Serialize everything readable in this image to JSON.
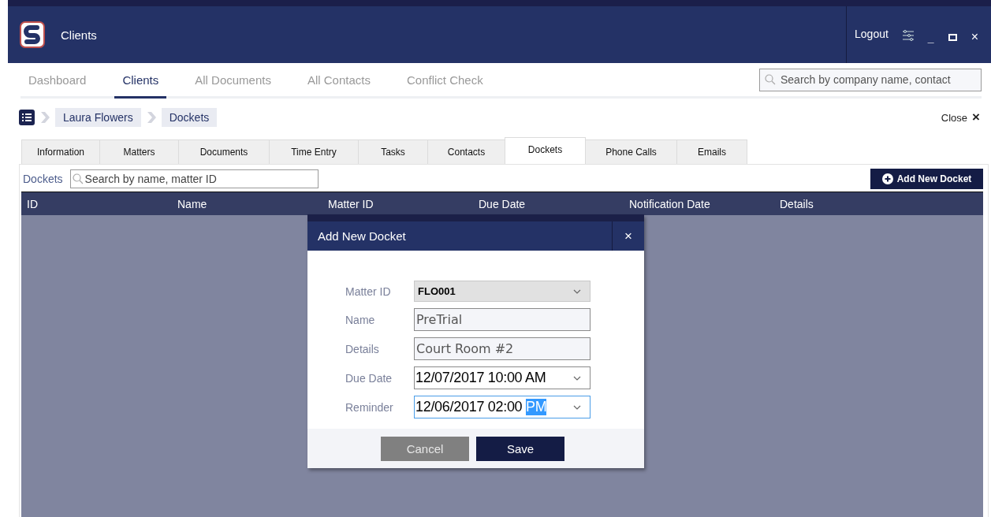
{
  "window": {
    "title": "Clients",
    "actions": [
      {
        "kind": "logout",
        "label": "Logout"
      },
      {
        "kind": "settings"
      },
      {
        "kind": "minimize",
        "label": "_"
      },
      {
        "kind": "maximize"
      },
      {
        "kind": "close",
        "label": "×"
      }
    ]
  },
  "nav": {
    "tabs": [
      {
        "label": "Dashboard",
        "selected": false
      },
      {
        "label": "Clients",
        "selected": true
      },
      {
        "label": "All Documents",
        "selected": false
      },
      {
        "label": "All Contacts",
        "selected": false
      },
      {
        "label": "Conflict Check",
        "selected": false
      }
    ],
    "search": {
      "placeholder": "Search by company name, contact"
    }
  },
  "breadcrumb": {
    "items": [
      "Laura Flowers",
      "Dockets"
    ],
    "close_label": "Close",
    "close_icon": "×"
  },
  "client_tabs": [
    {
      "label": "Information",
      "selected": false
    },
    {
      "label": "Matters",
      "selected": false
    },
    {
      "label": "Documents",
      "selected": false
    },
    {
      "label": "Time Entry",
      "selected": false
    },
    {
      "label": "Tasks",
      "selected": false
    },
    {
      "label": "Contacts",
      "selected": false
    },
    {
      "label": "Dockets",
      "selected": true
    },
    {
      "label": "Phone Calls",
      "selected": false
    },
    {
      "label": "Emails",
      "selected": false
    }
  ],
  "dockets": {
    "label": "Dockets",
    "search": {
      "placeholder": "Search by name, matter ID"
    },
    "add_button": "Add New Docket",
    "table": {
      "columns": [
        "ID",
        "Name",
        "Matter ID",
        "Due Date",
        "Notification Date",
        "Details"
      ]
    }
  },
  "dialog": {
    "title": "Add New Docket",
    "close": "×",
    "fields": [
      {
        "kind": "select",
        "label": "Matter ID",
        "value": "FLO001",
        "focused": false
      },
      {
        "kind": "text",
        "label": "Name",
        "value": "PreTrial",
        "focused": false
      },
      {
        "kind": "text",
        "label": "Details",
        "value": "Court Room #2",
        "focused": false
      },
      {
        "kind": "datetime",
        "label": "Due Date",
        "value": "12/07/2017 10:00 AM",
        "focused": false
      },
      {
        "kind": "datetime",
        "label": "Reminder",
        "value": "12/06/2017 02:00 ",
        "selected_text": "PM",
        "focused": true
      }
    ],
    "buttons": [
      {
        "kind": "secondary",
        "label": "Cancel"
      },
      {
        "kind": "primary",
        "label": "Save"
      }
    ]
  }
}
